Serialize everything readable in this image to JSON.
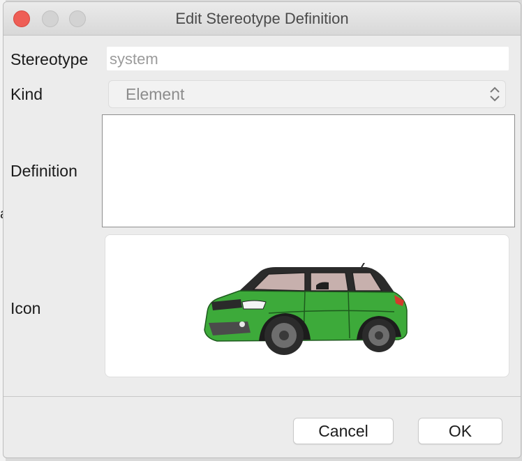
{
  "window": {
    "title": "Edit Stereotype Definition"
  },
  "background": {
    "edge_char": "a"
  },
  "form": {
    "stereotype_label": "Stereotype",
    "stereotype_value": "system",
    "kind_label": "Kind",
    "kind_value": "Element",
    "definition_label": "Definition",
    "definition_value": "",
    "icon_label": "Icon",
    "icon_image": "green-suv-car"
  },
  "buttons": {
    "cancel": "Cancel",
    "ok": "OK"
  },
  "colors": {
    "close_light": "#ee5e56",
    "car_body": "#3daa3a",
    "car_roof": "#2b2b2b"
  }
}
